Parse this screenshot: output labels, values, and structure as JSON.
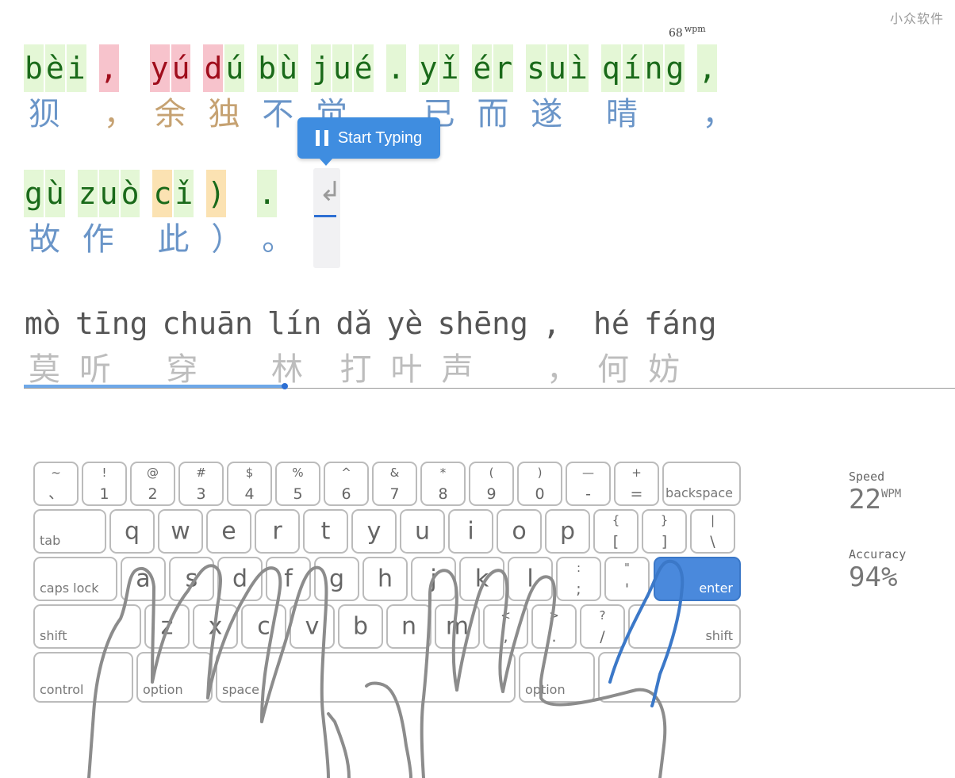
{
  "watermark": "小众软件",
  "live_wpm": {
    "value": "68",
    "unit": "wpm"
  },
  "start_button": {
    "label": "Start Typing",
    "icon": "pause-icon"
  },
  "enter_symbol": "↲",
  "lines": [
    {
      "cells": [
        {
          "py": [
            [
              "b",
              "ok"
            ],
            [
              "è",
              "ok"
            ],
            [
              "i",
              "ok"
            ]
          ],
          "hz": "狈",
          "hz_style": "blue"
        },
        {
          "py": [
            [
              ",",
              "err"
            ]
          ],
          "hz": "，",
          "hz_style": "tan"
        },
        {
          "py": [
            [
              "y",
              "err"
            ],
            [
              "ú",
              "err"
            ]
          ],
          "hz": "余",
          "hz_style": "tan"
        },
        {
          "py": [
            [
              "d",
              "err"
            ],
            [
              "ú",
              "ok"
            ]
          ],
          "hz": "独",
          "hz_style": "tan"
        },
        {
          "py": [
            [
              "b",
              "ok"
            ],
            [
              "ù",
              "ok"
            ]
          ],
          "hz": "不",
          "hz_style": "blue"
        },
        {
          "py": [
            [
              "j",
              "ok"
            ],
            [
              "u",
              "ok"
            ],
            [
              "é",
              "ok"
            ]
          ],
          "hz": "觉",
          "hz_style": "blue"
        },
        {
          "py": [
            [
              ".",
              "ok"
            ]
          ],
          "hz": "",
          "hz_style": "blue"
        },
        {
          "py": [
            [
              "y",
              "ok"
            ],
            [
              "ǐ",
              "ok"
            ]
          ],
          "hz": "已",
          "hz_style": "blue"
        },
        {
          "py": [
            [
              "é",
              "ok"
            ],
            [
              "r",
              "ok"
            ]
          ],
          "hz": "而",
          "hz_style": "blue"
        },
        {
          "py": [
            [
              "s",
              "ok"
            ],
            [
              "u",
              "ok"
            ],
            [
              "ì",
              "ok"
            ]
          ],
          "hz": "遂",
          "hz_style": "blue"
        },
        {
          "py": [
            [
              "q",
              "ok"
            ],
            [
              "í",
              "ok"
            ],
            [
              "n",
              "ok"
            ],
            [
              "g",
              "ok"
            ]
          ],
          "hz": "晴",
          "hz_style": "blue"
        },
        {
          "py": [
            [
              ",",
              "ok"
            ]
          ],
          "hz": "，",
          "hz_style": "blue"
        }
      ]
    },
    {
      "cells": [
        {
          "py": [
            [
              "g",
              "ok"
            ],
            [
              "ù",
              "ok"
            ]
          ],
          "hz": "故",
          "hz_style": "blue"
        },
        {
          "py": [
            [
              "z",
              "ok"
            ],
            [
              "u",
              "ok"
            ],
            [
              "ò",
              "ok"
            ]
          ],
          "hz": "作",
          "hz_style": "blue"
        },
        {
          "py": [
            [
              "c",
              "fix"
            ],
            [
              "ǐ",
              "ok"
            ]
          ],
          "hz": "此",
          "hz_style": "blue"
        },
        {
          "py": [
            [
              ")",
              "fix"
            ]
          ],
          "hz": "）",
          "hz_style": "blue"
        },
        {
          "py": [
            [
              ".",
              "ok"
            ]
          ],
          "hz": "。",
          "hz_style": "blue"
        }
      ]
    },
    {
      "cells": [
        {
          "py": [
            [
              "mò",
              "pend"
            ]
          ],
          "hz": "莫",
          "hz_style": "gray"
        },
        {
          "py": [
            [
              "tīng",
              "pend"
            ]
          ],
          "hz": "听",
          "hz_style": "gray"
        },
        {
          "py": [
            [
              "chuān",
              "pend"
            ]
          ],
          "hz": "穿",
          "hz_style": "gray"
        },
        {
          "py": [
            [
              "lín",
              "pend"
            ]
          ],
          "hz": "林",
          "hz_style": "gray"
        },
        {
          "py": [
            [
              "dǎ",
              "pend"
            ]
          ],
          "hz": "打",
          "hz_style": "gray"
        },
        {
          "py": [
            [
              "yè",
              "pend"
            ]
          ],
          "hz": "叶",
          "hz_style": "gray"
        },
        {
          "py": [
            [
              "shēng",
              "pend"
            ]
          ],
          "hz": "声",
          "hz_style": "gray"
        },
        {
          "py": [
            [
              ",",
              "pend"
            ]
          ],
          "hz": "，",
          "hz_style": "gray"
        },
        {
          "py": [
            [
              "hé",
              "pend"
            ]
          ],
          "hz": "何",
          "hz_style": "gray"
        },
        {
          "py": [
            [
              "fáng",
              "pend"
            ]
          ],
          "hz": "妨",
          "hz_style": "gray"
        }
      ]
    }
  ],
  "progress_fraction": 0.28,
  "keyboard": {
    "row1": [
      [
        "~",
        "、"
      ],
      [
        "!",
        "1"
      ],
      [
        "@",
        "2"
      ],
      [
        "#",
        "3"
      ],
      [
        "$",
        "4"
      ],
      [
        "%",
        "5"
      ],
      [
        "^",
        "6"
      ],
      [
        "&",
        "7"
      ],
      [
        "*",
        "8"
      ],
      [
        "(",
        "9"
      ],
      [
        ")",
        "0"
      ],
      [
        "—",
        "-"
      ],
      [
        "+",
        "="
      ]
    ],
    "backspace": "backspace",
    "tab": "tab",
    "row2": [
      "q",
      "w",
      "e",
      "r",
      "t",
      "y",
      "u",
      "i",
      "o",
      "p"
    ],
    "row2_sym": [
      [
        "{",
        "["
      ],
      [
        "}",
        "]"
      ],
      [
        "|",
        "\\"
      ]
    ],
    "caps": "caps lock",
    "row3": [
      "a",
      "s",
      "d",
      "f",
      "g",
      "h",
      "j",
      "k",
      "l"
    ],
    "row3_sym": [
      [
        ":",
        ";"
      ],
      [
        "\"",
        "'"
      ]
    ],
    "enter": "enter",
    "shift_left": "shift",
    "row4": [
      "z",
      "x",
      "c",
      "v",
      "b",
      "n",
      "m"
    ],
    "row4_sym": [
      [
        "<",
        ","
      ],
      [
        ">",
        "."
      ],
      [
        "?",
        "/"
      ]
    ],
    "shift_right": "shift",
    "control": "control",
    "option_left": "option",
    "space": "space",
    "option_right": "option",
    "active_key": "enter"
  },
  "stats": {
    "speed_label": "Speed",
    "speed_value": "22",
    "speed_unit": "WPM",
    "accuracy_label": "Accuracy",
    "accuracy_value": "94%"
  },
  "colors": {
    "accent": "#4a89dc",
    "correct_bg": "#e4f7d6",
    "error_bg": "#f7c3cc",
    "fixed_bg": "#fbe2b2"
  }
}
